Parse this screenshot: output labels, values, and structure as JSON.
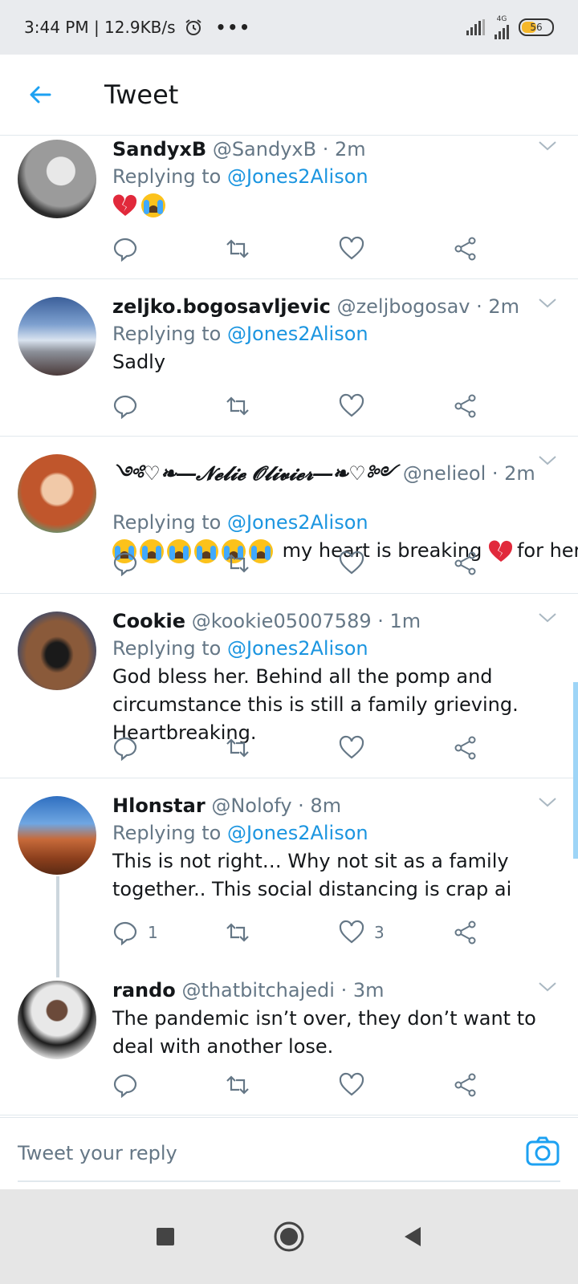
{
  "status_bar": {
    "time_speed": "3:44 PM | 12.9KB/s",
    "dots": "•••",
    "network": "4G",
    "battery": "56"
  },
  "header": {
    "title": "Tweet"
  },
  "replying_prefix": "Replying to",
  "tweets": [
    {
      "name": "SandyxB",
      "handle": "@SandyxB · 2m",
      "reply_to": "@Jones2Alison",
      "text": "",
      "emoji": [
        "broken-heart",
        "crying-face"
      ]
    },
    {
      "name": "zeljko.bogosavljevic",
      "handle": "@zeljbogosav · 2m",
      "reply_to": "@Jones2Alison",
      "text": "Sadly"
    },
    {
      "name": "༺♡❧―𝓝𝓮𝓵𝓲𝓮 𝓞𝓵𝓲𝓿𝓲𝓮𝓻―❧♡༻",
      "handle": "@nelieol · 2m",
      "reply_to": "@Jones2Alison",
      "text_a": "my heart is breaking",
      "text_b": "for her"
    },
    {
      "name": "Cookie",
      "handle": "@kookie05007589 · 1m",
      "reply_to": "@Jones2Alison",
      "text": "God bless her.  Behind all the pomp and circumstance this is still a family grieving. Heartbreaking."
    },
    {
      "name": "Hlonstar",
      "handle": "@Nolofy · 8m",
      "reply_to": "@Jones2Alison",
      "text": "This is not right… Why not sit as a family together.. This social distancing is crap ai",
      "reply_count": "1",
      "like_count": "3"
    },
    {
      "name": "rando",
      "handle": "@thatbitchajedi · 3m",
      "text": "The pandemic isn’t over, they don’t want to deal with another lose."
    }
  ],
  "reply_bar": {
    "placeholder": "Tweet your reply"
  },
  "colors": {
    "accent": "#1b95e0",
    "muted": "#657786",
    "divider": "#e1e8ed"
  }
}
